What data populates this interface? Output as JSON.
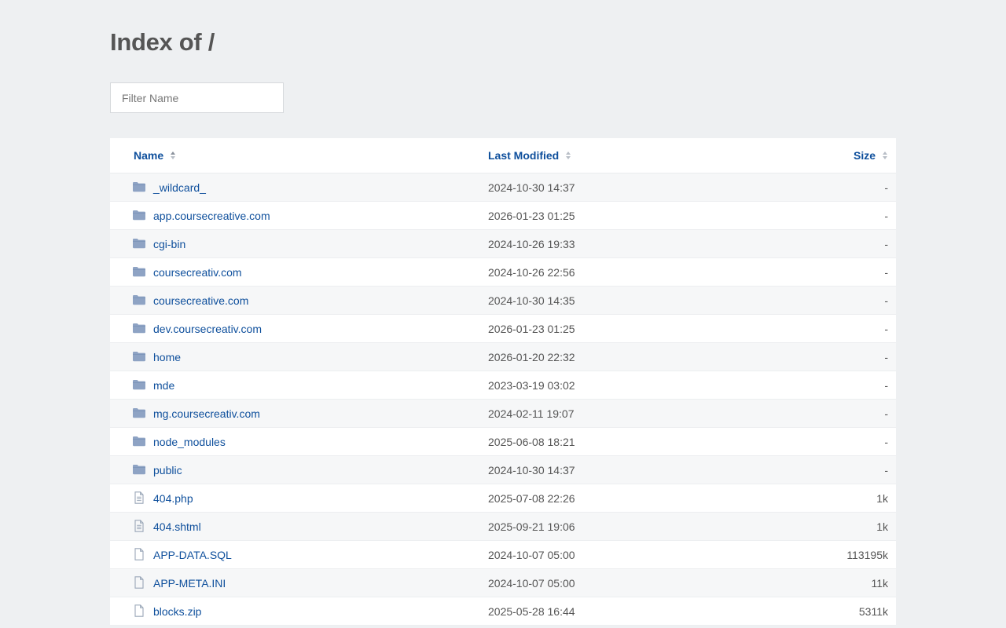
{
  "page": {
    "title": "Index of /",
    "filter_placeholder": "Filter Name"
  },
  "table": {
    "headers": {
      "name": "Name",
      "last_modified": "Last Modified",
      "size": "Size"
    },
    "rows": [
      {
        "type": "folder",
        "name": "_wildcard_",
        "modified": "2024-10-30 14:37",
        "size": "-"
      },
      {
        "type": "folder",
        "name": "app.coursecreative.com",
        "modified": "2026-01-23 01:25",
        "size": "-"
      },
      {
        "type": "folder",
        "name": "cgi-bin",
        "modified": "2024-10-26 19:33",
        "size": "-"
      },
      {
        "type": "folder",
        "name": "coursecreativ.com",
        "modified": "2024-10-26 22:56",
        "size": "-"
      },
      {
        "type": "folder",
        "name": "coursecreative.com",
        "modified": "2024-10-30 14:35",
        "size": "-"
      },
      {
        "type": "folder",
        "name": "dev.coursecreativ.com",
        "modified": "2026-01-23 01:25",
        "size": "-"
      },
      {
        "type": "folder",
        "name": "home",
        "modified": "2026-01-20 22:32",
        "size": "-"
      },
      {
        "type": "folder",
        "name": "mde",
        "modified": "2023-03-19 03:02",
        "size": "-"
      },
      {
        "type": "folder",
        "name": "mg.coursecreativ.com",
        "modified": "2024-02-11 19:07",
        "size": "-"
      },
      {
        "type": "folder",
        "name": "node_modules",
        "modified": "2025-06-08 18:21",
        "size": "-"
      },
      {
        "type": "folder",
        "name": "public",
        "modified": "2024-10-30 14:37",
        "size": "-"
      },
      {
        "type": "text-file",
        "name": "404.php",
        "modified": "2025-07-08 22:26",
        "size": "1k"
      },
      {
        "type": "text-file",
        "name": "404.shtml",
        "modified": "2025-09-21 19:06",
        "size": "1k"
      },
      {
        "type": "file",
        "name": "APP-DATA.SQL",
        "modified": "2024-10-07 05:00",
        "size": "113195k"
      },
      {
        "type": "file",
        "name": "APP-META.INI",
        "modified": "2024-10-07 05:00",
        "size": "11k"
      },
      {
        "type": "file",
        "name": "blocks.zip",
        "modified": "2025-05-28 16:44",
        "size": "5311k"
      }
    ]
  },
  "colors": {
    "background": "#eef0f2",
    "link": "#0e4f9c",
    "folder_icon": "#8ea3c4",
    "file_icon": "#9aa7b8"
  }
}
